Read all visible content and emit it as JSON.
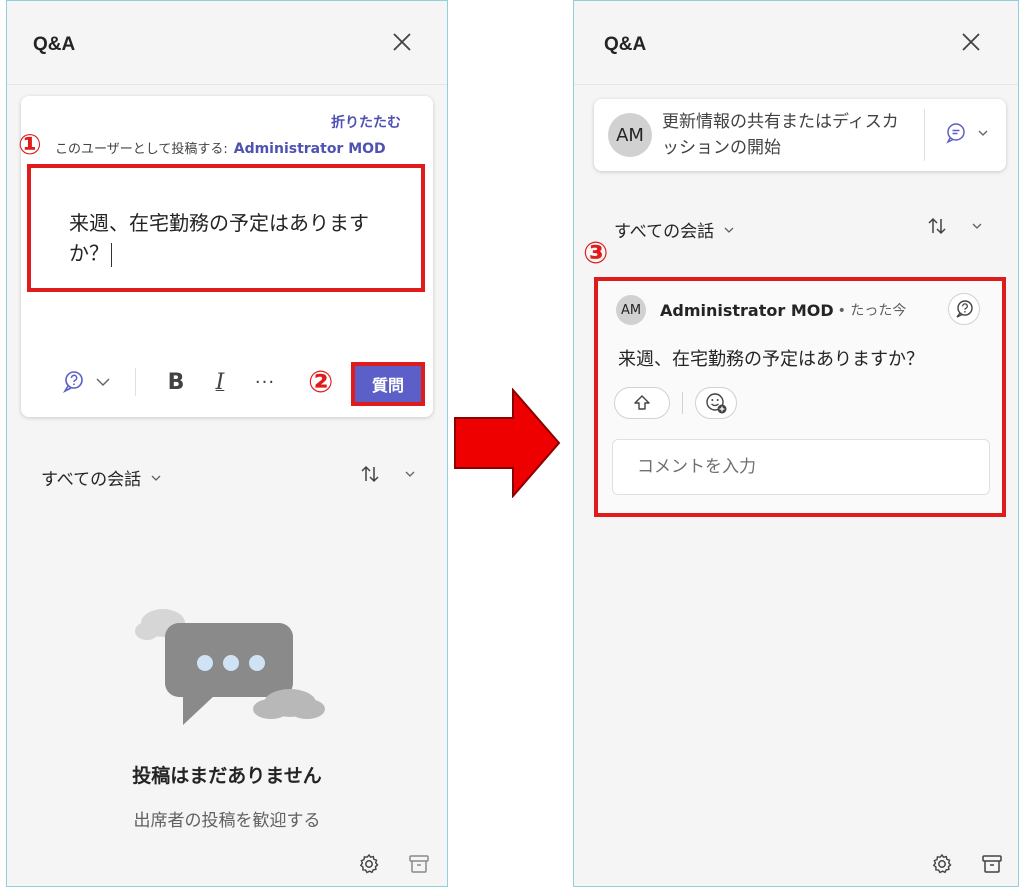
{
  "left_panel": {
    "title": "Q&A",
    "composer": {
      "collapse_label": "折りたたむ",
      "post_as_label": "このユーザーとして投稿する:",
      "user_name": "Administrator MOD",
      "question_text": "来週、在宅勤務の予定はありますか？",
      "toolbar": {
        "bold": "B",
        "italic": "I",
        "more": "···"
      },
      "submit_label": "質問"
    },
    "conversations": {
      "filter_label": "すべての会話"
    },
    "empty_state": {
      "title": "投稿はまだありません",
      "subtitle": "出席者の投稿を歓迎する"
    }
  },
  "right_panel": {
    "title": "Q&A",
    "start_card": {
      "avatar_initials": "AM",
      "prompt": "更新情報の共有またはディスカッションの開始"
    },
    "conversations": {
      "filter_label": "すべての会話"
    },
    "post": {
      "avatar_initials": "AM",
      "author": "Administrator MOD",
      "time": "• たった今",
      "body": "来週、在宅勤務の予定はありますか？",
      "comment_placeholder": "コメントを入力"
    }
  },
  "callouts": {
    "step1": "①",
    "step2": "②",
    "step3": "③"
  },
  "colors": {
    "accent": "#5b5fc7",
    "link": "#4f52b2",
    "highlight": "#e01b1b",
    "arrow": "#ee0000"
  },
  "icons": [
    "close-icon",
    "question-type-icon",
    "chevron-down-icon",
    "sort-icon",
    "settings-icon",
    "archive-icon",
    "discussion-icon",
    "upvote-icon",
    "add-reaction-icon",
    "reply-question-icon"
  ]
}
